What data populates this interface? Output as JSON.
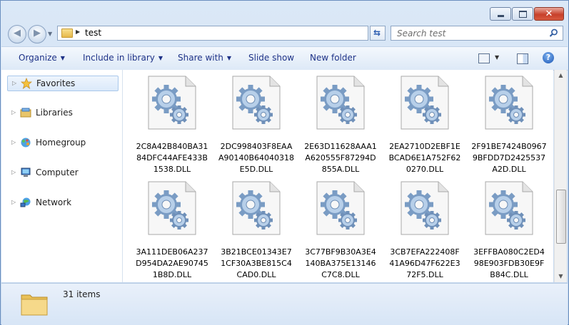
{
  "window": {
    "caption_buttons": [
      {
        "name": "minimize",
        "icon": "minimize-icon"
      },
      {
        "name": "maximize",
        "icon": "maximize-icon"
      },
      {
        "name": "close",
        "icon": "close-icon",
        "glyph": "✕"
      }
    ]
  },
  "address": {
    "path": "test",
    "folder_icon": "folder-icon"
  },
  "search": {
    "placeholder": "Search test",
    "icon": "search-icon"
  },
  "toolbar": {
    "organize": "Organize",
    "include_in_library": "Include in library",
    "share_with": "Share with",
    "slide_show": "Slide show",
    "new_folder": "New folder",
    "help_glyph": "?"
  },
  "sidebar": {
    "items": [
      {
        "label": "Favorites",
        "icon": "star-icon",
        "selected": true
      },
      {
        "label": "Libraries",
        "icon": "libraries-icon"
      },
      {
        "label": "Homegroup",
        "icon": "homegroup-icon"
      },
      {
        "label": "Computer",
        "icon": "computer-icon"
      },
      {
        "label": "Network",
        "icon": "network-icon"
      }
    ]
  },
  "files": [
    {
      "lines": [
        "2C8A42B840BA31",
        "84DFC44AFE433B",
        "1538.DLL"
      ]
    },
    {
      "lines": [
        "2DC998403F8EAA",
        "A90140B64040318",
        "E5D.DLL"
      ]
    },
    {
      "lines": [
        "2E63D11628AAA1",
        "A620555F87294D",
        "855A.DLL"
      ]
    },
    {
      "lines": [
        "2EA2710D2EBF1E",
        "BCAD6E1A752F62",
        "0270.DLL"
      ]
    },
    {
      "lines": [
        "2F91BE7424B0967",
        "9BFDD7D2425537",
        "A2D.DLL"
      ]
    },
    {
      "lines": [
        "3A111DEB06A237",
        "D954DA2AE90745",
        "1B8D.DLL"
      ]
    },
    {
      "lines": [
        "3B21BCE01343E7",
        "1CF30A3BE815C4",
        "CAD0.DLL"
      ]
    },
    {
      "lines": [
        "3C77BF9B30A3E4",
        "140BA375E13146",
        "C7C8.DLL"
      ]
    },
    {
      "lines": [
        "3CB7EFA222408F",
        "41A96D47F622E3",
        "72F5.DLL"
      ]
    },
    {
      "lines": [
        "3EFFBA080C2ED4",
        "98E903FDB30E9F",
        "B84C.DLL"
      ]
    }
  ],
  "details": {
    "item_count": "31 items"
  }
}
